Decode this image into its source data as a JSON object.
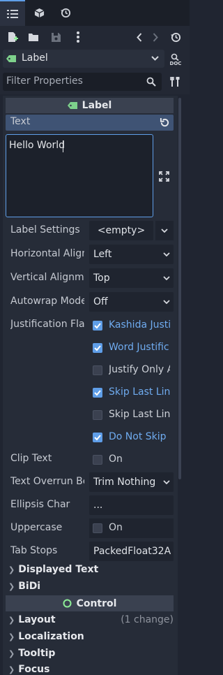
{
  "tabs": {
    "icons": [
      "list-icon",
      "cube-icon",
      "history-icon"
    ]
  },
  "object": {
    "name": "Label",
    "doc_label": "DOC"
  },
  "filter": {
    "placeholder": "Filter Properties"
  },
  "section": {
    "title": "Label"
  },
  "text_prop": {
    "label": "Text",
    "value": "Hello World"
  },
  "props": {
    "label_settings": {
      "label": "Label Settings",
      "value": "<empty>"
    },
    "horizontal_align": {
      "label": "Horizontal Align",
      "value": "Left"
    },
    "vertical_align": {
      "label": "Vertical Alignme",
      "value": "Top"
    },
    "autowrap": {
      "label": "Autowrap Mode",
      "value": "Off"
    },
    "justification": {
      "label": "Justification Flag",
      "flags": [
        {
          "label": "Kashida Justi",
          "checked": true
        },
        {
          "label": "Word Justific",
          "checked": true
        },
        {
          "label": "Justify Only A",
          "checked": false
        },
        {
          "label": "Skip Last Lin",
          "checked": true
        },
        {
          "label": "Skip Last Lin",
          "checked": false
        },
        {
          "label": "Do Not Skip S",
          "checked": true
        }
      ]
    },
    "clip_text": {
      "label": "Clip Text",
      "value": "On",
      "checked": false
    },
    "text_overrun": {
      "label": "Text Overrun Be",
      "value": "Trim Nothing"
    },
    "ellipsis": {
      "label": "Ellipsis Char",
      "value": "..."
    },
    "uppercase": {
      "label": "Uppercase",
      "value": "On",
      "checked": false
    },
    "tab_stops": {
      "label": "Tab Stops",
      "value": "PackedFloat32A"
    }
  },
  "groups": {
    "displayed_text": "Displayed Text",
    "bidi": "BiDi"
  },
  "control": {
    "title": "Control",
    "layout": "Layout",
    "layout_change": "(1 change)",
    "localization": "Localization",
    "tooltip": "Tooltip",
    "focus": "Focus"
  },
  "colors": {
    "accent": "#5f9ee8",
    "label_icon": "#7ed18c",
    "control_icon": "#8eef97"
  }
}
